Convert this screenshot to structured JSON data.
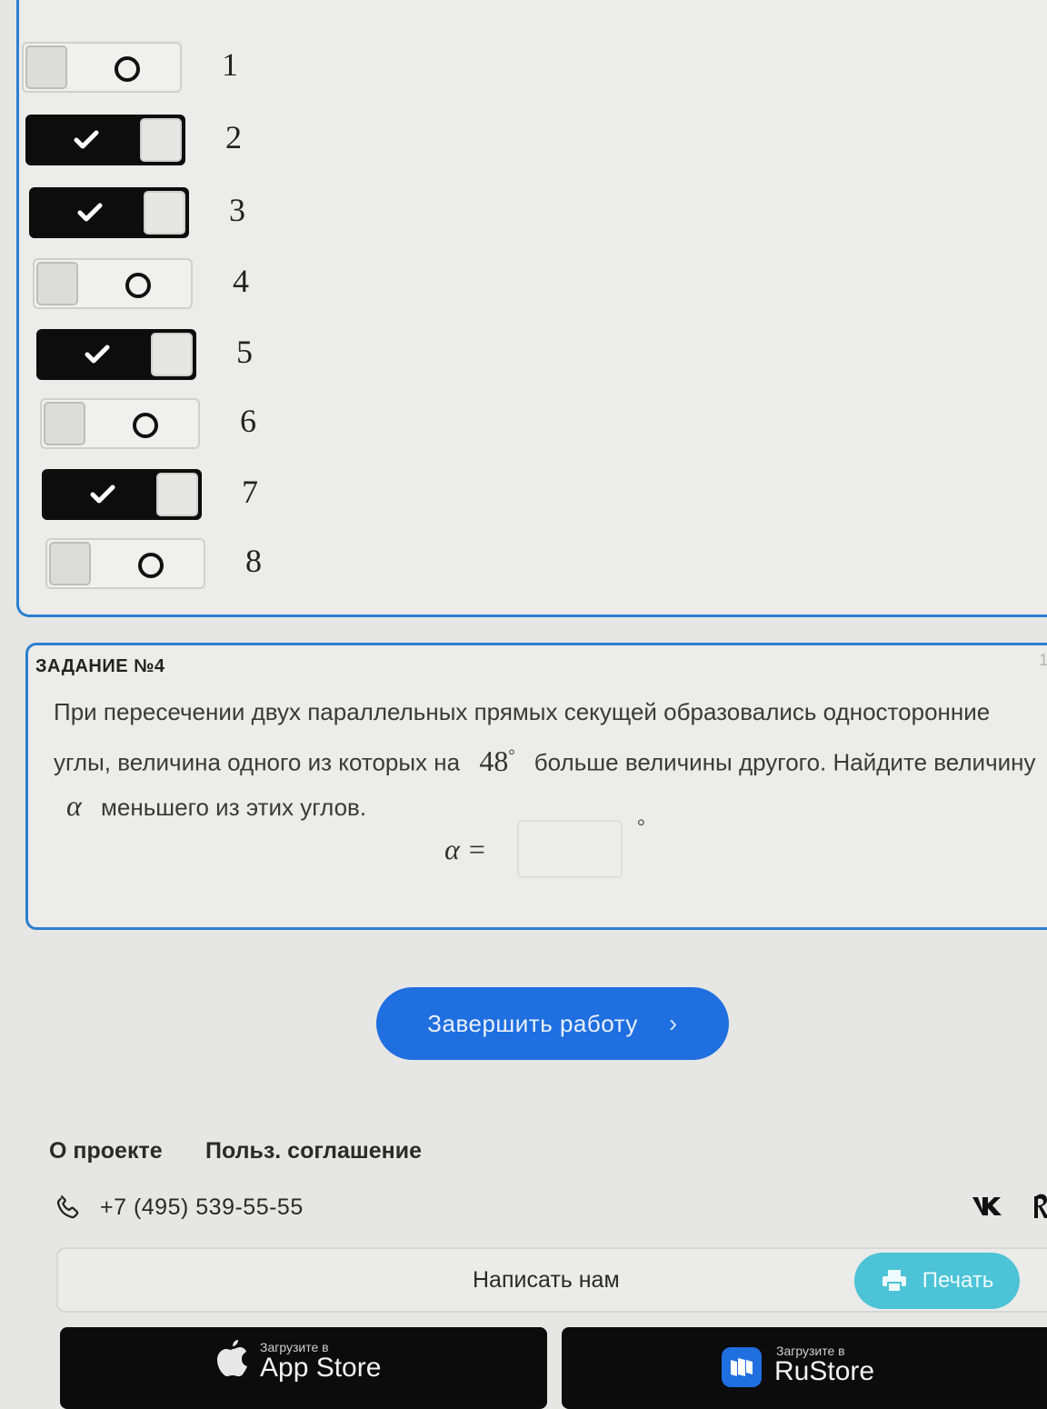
{
  "toggles": [
    {
      "num": "1",
      "on": false
    },
    {
      "num": "2",
      "on": true
    },
    {
      "num": "3",
      "on": true
    },
    {
      "num": "4",
      "on": false
    },
    {
      "num": "5",
      "on": true
    },
    {
      "num": "6",
      "on": false
    },
    {
      "num": "7",
      "on": true
    },
    {
      "num": "8",
      "on": false
    }
  ],
  "task": {
    "label": "ЗАДАНИЕ №4",
    "id": "117",
    "text_part1": "При пересечении двух параллельных прямых секущей образовались односторонние углы, величина одного из которых на",
    "angle": "48",
    "degree": "°",
    "text_part2": "больше величины другого. Найдите величину",
    "alpha": "α",
    "text_part3": "меньшего из этих углов.",
    "answer_label": "α =",
    "answer_value": "",
    "answer_unit": "°"
  },
  "finish_button": {
    "label": "Завершить работу",
    "chevron": "›"
  },
  "footer": {
    "about": "О проекте",
    "agreement": "Польз. соглашение",
    "phone": "+7 (495) 539-55-55",
    "vk": "vk",
    "write_us": "Написать нам",
    "print": "Печать",
    "appstore_small": "Загрузите в",
    "appstore_big": "App Store",
    "rustore_small": "Загрузите в",
    "rustore_big": "RuStore"
  },
  "colors": {
    "accent": "#2b7fd0",
    "finish": "#1f6fe0",
    "print": "#4cc3d6"
  }
}
